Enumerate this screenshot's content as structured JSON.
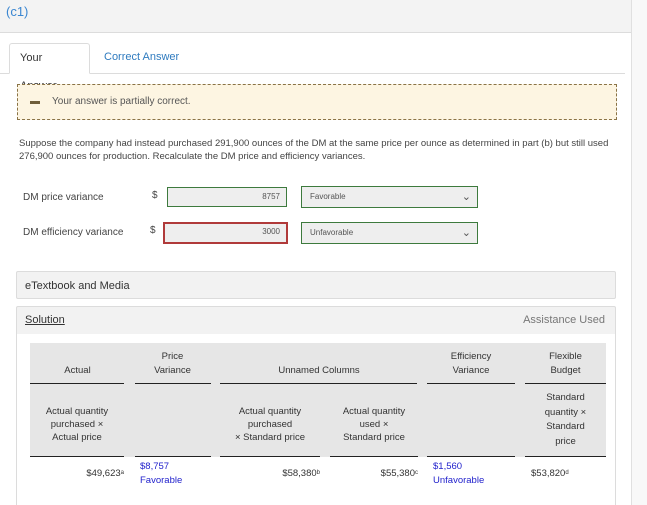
{
  "part_label": "(c1)",
  "tabs": [
    {
      "label": "Your Answer",
      "active": true
    },
    {
      "label": "Correct Answer",
      "active": false
    }
  ],
  "notice": {
    "icon": "minus-icon",
    "message": "Your answer is partially correct."
  },
  "question": "Suppose the company had instead purchased 291,900 ounces of the DM at the same price per ounce as determined in part (b) but still used 276,900 ounces for production. Recalculate the DM price and efficiency variances.",
  "rows": [
    {
      "label": "DM price variance",
      "currency": "$",
      "value": "8757",
      "status": "correct",
      "select_value": "Favorable"
    },
    {
      "label": "DM efficiency variance",
      "currency": "$",
      "value": "3000",
      "status": "incorrect",
      "select_value": "Unfavorable"
    }
  ],
  "etextbook": {
    "title": "eTextbook and Media"
  },
  "solution": {
    "title": "Solution",
    "assistance": "Assistance Used",
    "group_headers": {
      "actual": "Actual",
      "price_variance_1": "Price",
      "price_variance_2": "Variance",
      "unnamed": "Unnamed Columns",
      "efficiency_variance_1": "Efficiency",
      "efficiency_variance_2": "Variance",
      "flexible_budget_1": "Flexible",
      "flexible_budget_2": "Budget"
    },
    "sub_headers": {
      "actual": [
        "Actual quantity",
        "purchased ×",
        "Actual price"
      ],
      "aq_purchased_sp": [
        "Actual quantity",
        "purchased",
        "× Standard price"
      ],
      "aq_used_sp": [
        "Actual quantity",
        "used ×",
        "Standard price"
      ],
      "flexible": [
        "Standard",
        "quantity ×",
        "Standard",
        "price"
      ]
    },
    "values": {
      "actual": {
        "amount": "$49,623",
        "note": "a"
      },
      "price_variance": {
        "amount": "$8,757",
        "label": "Favorable"
      },
      "aq_purchased_sp": {
        "amount": "$58,380",
        "note": "b"
      },
      "aq_used_sp": {
        "amount": "$55,380",
        "note": "c"
      },
      "efficiency_variance": {
        "amount": "$1,560",
        "label": "Unfavorable"
      },
      "flexible": {
        "amount": "$53,820",
        "note": "d"
      }
    }
  }
}
